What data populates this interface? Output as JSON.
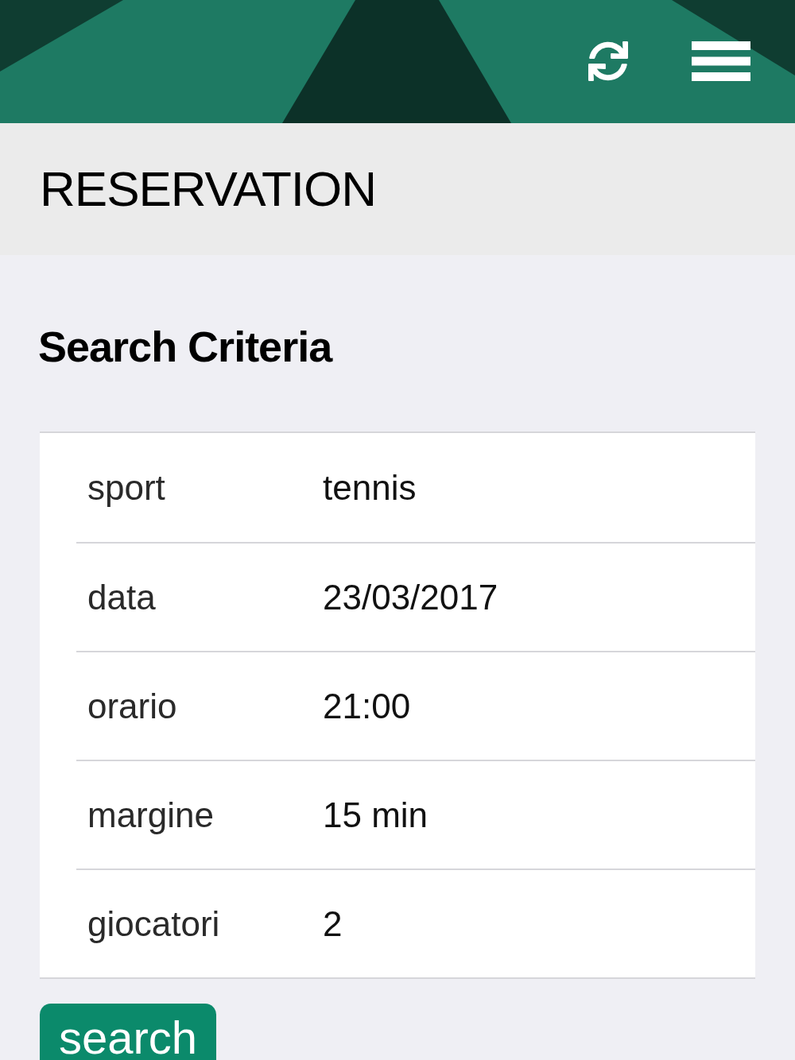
{
  "page": {
    "title": "RESERVATION"
  },
  "section": {
    "heading": "Search Criteria"
  },
  "criteria": [
    {
      "label": "sport",
      "value": "tennis"
    },
    {
      "label": "data",
      "value": "23/03/2017"
    },
    {
      "label": "orario",
      "value": "21:00"
    },
    {
      "label": "margine",
      "value": "15 min"
    },
    {
      "label": "giocatori",
      "value": "2"
    }
  ],
  "search_button": {
    "label": "search"
  }
}
